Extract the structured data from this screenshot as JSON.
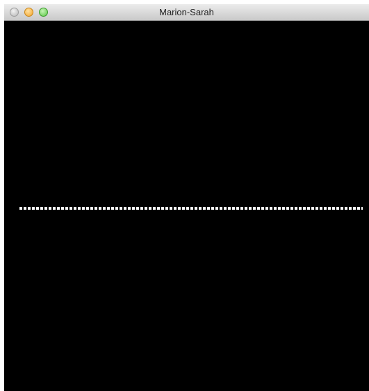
{
  "window": {
    "title": "Marion-Sarah"
  },
  "icons": {
    "close": "close-icon",
    "minimize": "minimize-icon",
    "zoom": "zoom-icon"
  }
}
